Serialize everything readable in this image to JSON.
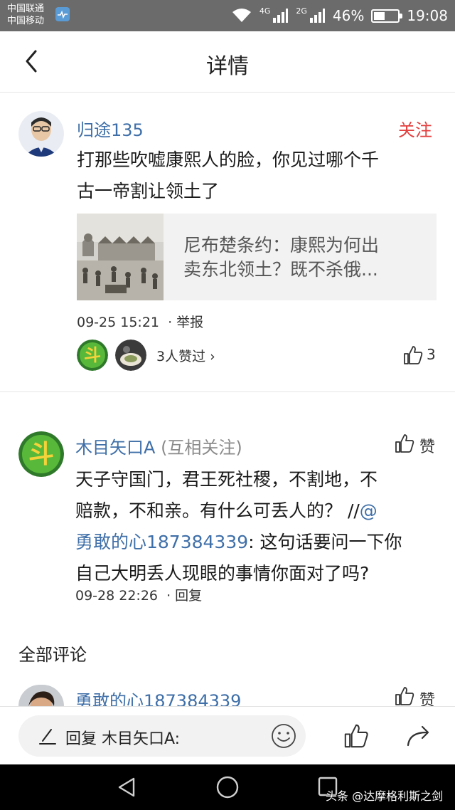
{
  "status_bar": {
    "carrier1": "中国联通",
    "carrier2": "中国移动",
    "net1": "4G",
    "net2": "2G",
    "battery": "46%",
    "battery_level": 0.46,
    "time": "19:08"
  },
  "header": {
    "title": "详情"
  },
  "main_comment": {
    "username": "归途135",
    "follow_label": "关注",
    "text_line1": "打那些吹嘘康熙人的脸，你见过哪个千",
    "text_line2": "古一帝割让领土了",
    "article": {
      "title_line1": "尼布楚条约：康熙为何出",
      "title_line2": "卖东北领土？既不杀俄..."
    },
    "time": "09-25 15:21",
    "report_label": "· 举报",
    "likers_text": "3人赞过 ›",
    "like_count": "3"
  },
  "reply": {
    "username": "木目矢口A",
    "mutual": "(互相关注)",
    "like_label": "赞",
    "line1": "天子守国门，君王死社稷，不割地，不",
    "line2": "赔款，不和亲。有什么可丢人的？ //",
    "mention_at": "@",
    "mention": "勇敢的心187384339",
    "line3_rest": ": 这句话要问一下你",
    "line4": "自己大明丢人现眼的事情你面对了吗?",
    "time": "09-28 22:26",
    "reply_label": "· 回复"
  },
  "all_comments": {
    "title": "全部评论",
    "first": {
      "username": "勇敢的心187384339",
      "like_label": "赞"
    }
  },
  "bottom_bar": {
    "reply_placeholder": "回复 木目矢口A:"
  },
  "watermark": "头条 @达摩格利斯之剑",
  "colors": {
    "link_blue": "#3f6fa8",
    "follow_red": "#e33e3e",
    "status_bar": "#6b6b6b"
  },
  "icons": [
    "back-arrow-icon",
    "pen-icon",
    "emoji-icon",
    "thumbs-up-icon",
    "share-icon",
    "wifi-icon",
    "signal-icon",
    "battery-icon"
  ]
}
